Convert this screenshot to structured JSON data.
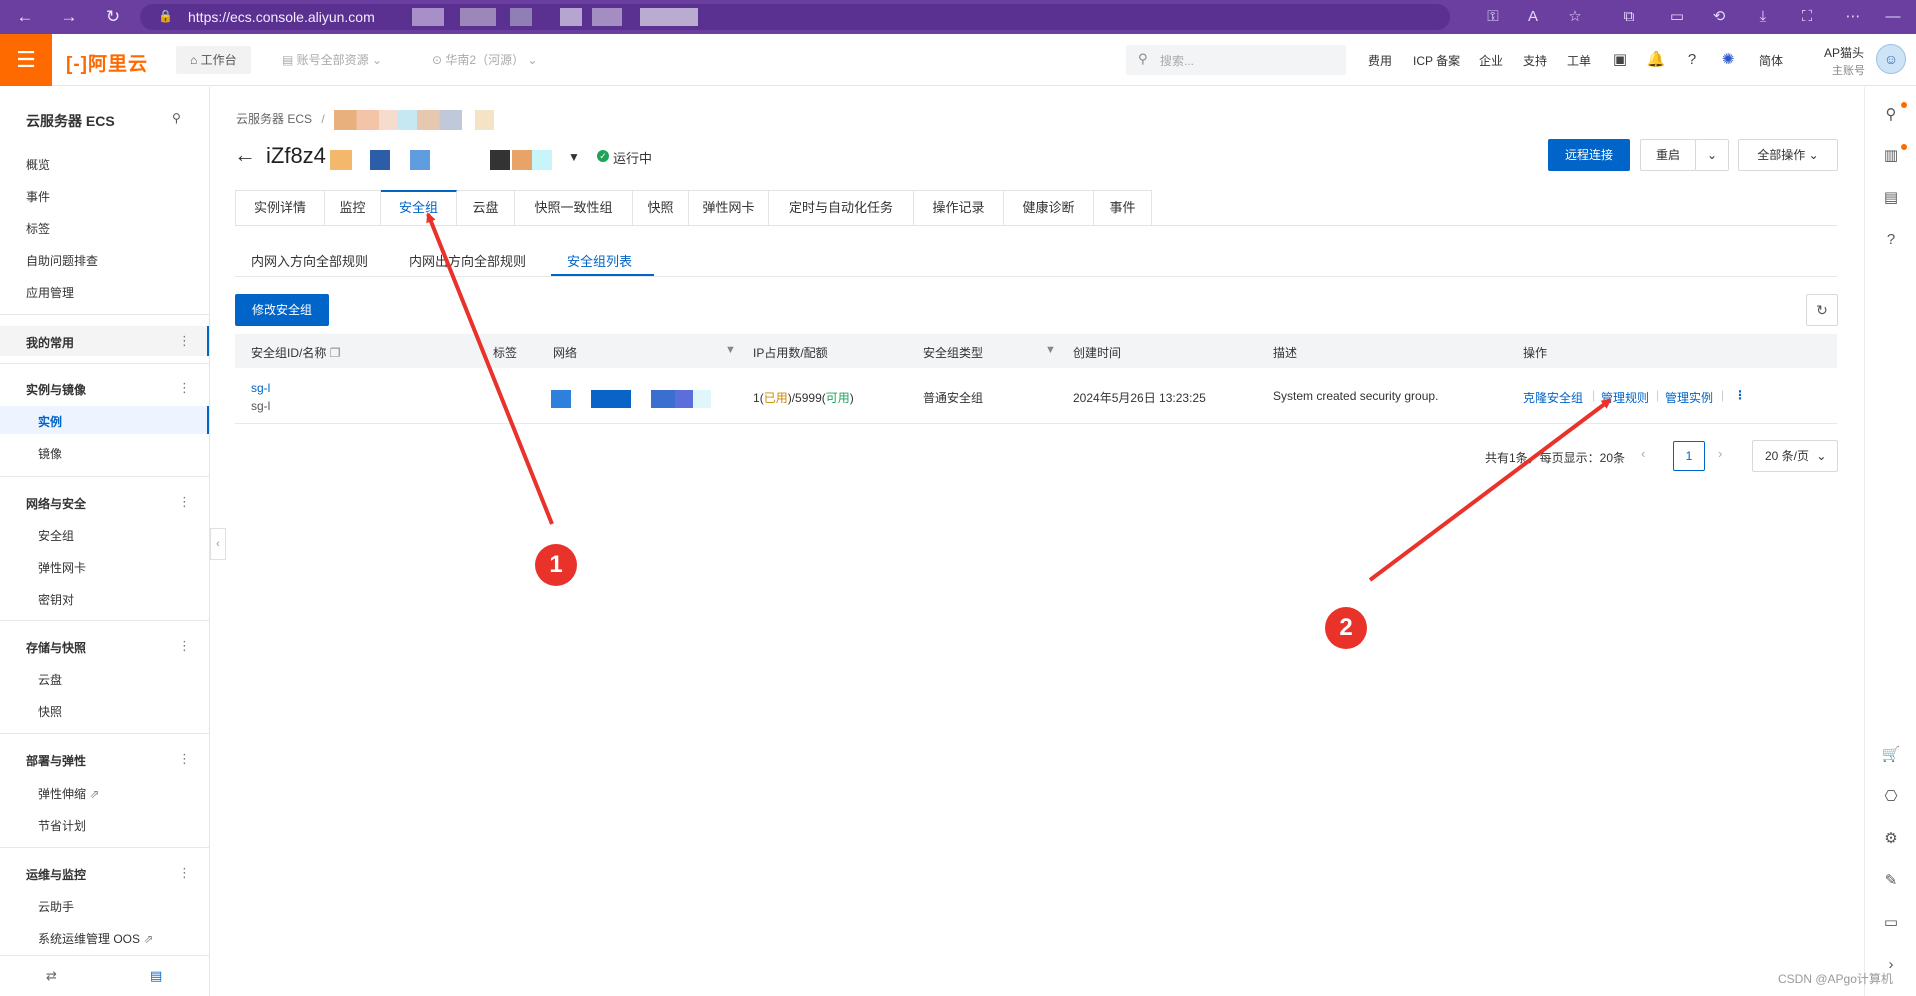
{
  "browser": {
    "url": "https://ecs.console.aliyun.com",
    "accent": "#6b3fa0"
  },
  "topnav": {
    "logo": "阿里云",
    "workbench": "工作台",
    "account_resources": "账号全部资源",
    "region": "华南2（河源）",
    "search_placeholder": "搜索...",
    "links": [
      "费用",
      "ICP 备案",
      "企业",
      "支持",
      "工单"
    ],
    "lang": "简体",
    "user_name": "AP猫头",
    "user_sub": "主账号",
    "brand_color": "#ff6a00"
  },
  "sidebar": {
    "title": "云服务器 ECS",
    "items": [
      "概览",
      "事件",
      "标签",
      "自助问题排查",
      "应用管理"
    ],
    "common": "我的常用",
    "groups": [
      {
        "title": "实例与镜像",
        "items": [
          "实例",
          "镜像"
        ]
      },
      {
        "title": "网络与安全",
        "items": [
          "安全组",
          "弹性网卡",
          "密钥对"
        ]
      },
      {
        "title": "存储与快照",
        "items": [
          "云盘",
          "快照"
        ]
      },
      {
        "title": "部署与弹性",
        "items": [
          "弹性伸缩",
          "节省计划"
        ]
      },
      {
        "title": "运维与监控",
        "items": [
          "云助手",
          "系统运维管理 OOS"
        ]
      }
    ]
  },
  "breadcrumb": {
    "root": "云服务器 ECS",
    "separator": "/"
  },
  "instance": {
    "title": "iZf8z4",
    "status": "运行中"
  },
  "actions": {
    "remote": "远程连接",
    "restart": "重启",
    "all": "全部操作"
  },
  "tabs": [
    "实例详情",
    "监控",
    "安全组",
    "云盘",
    "快照一致性组",
    "快照",
    "弹性网卡",
    "定时与自动化任务",
    "操作记录",
    "健康诊断",
    "事件"
  ],
  "subtabs": [
    "内网入方向全部规则",
    "内网出方向全部规则",
    "安全组列表"
  ],
  "modify_button": "修改安全组",
  "table": {
    "columns": [
      "安全组ID/名称",
      "标签",
      "网络",
      "IP占用数/配额",
      "安全组类型",
      "创建时间",
      "描述",
      "操作"
    ],
    "rows": [
      {
        "id": "sg-l",
        "name": "sg-l",
        "ip_used_count": "1",
        "ip_used_label": "已用",
        "ip_quota": "5999",
        "ip_avail_label": "可用",
        "type": "普通安全组",
        "created": "2024年5月26日 13:23:25",
        "description": "System created security group.",
        "ops": [
          "克隆安全组",
          "管理规则",
          "管理实例"
        ]
      }
    ]
  },
  "pagination": {
    "total": "共有1条，每页显示：20条",
    "page": "1",
    "size": "20 条/页"
  },
  "annotations": [
    "1",
    "2"
  ],
  "watermark": "CSDN @APgo计算机"
}
